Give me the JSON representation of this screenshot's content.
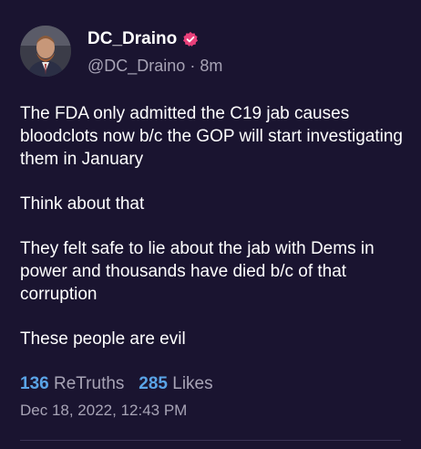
{
  "author": {
    "display_name": "DC_Draino",
    "handle": "@DC_Draino",
    "separator": "·",
    "time_ago": "8m",
    "verified_icon": "verified-badge-icon"
  },
  "post": {
    "paragraphs": [
      "The FDA only admitted the C19 jab causes bloodclots now b/c the GOP will start investigating them in January",
      "Think about that",
      "They felt safe to lie about the jab with Dems in power and thousands have died b/c of that corruption",
      "These people are evil"
    ]
  },
  "stats": {
    "retruths_count": "136",
    "retruths_label": "ReTruths",
    "likes_count": "285",
    "likes_label": "Likes"
  },
  "timestamp": "Dec 18, 2022, 12:43 PM",
  "colors": {
    "background": "#1a1430",
    "accent": "#5aa3e6",
    "muted": "#a7a3b5",
    "verified": "#e8407a"
  }
}
